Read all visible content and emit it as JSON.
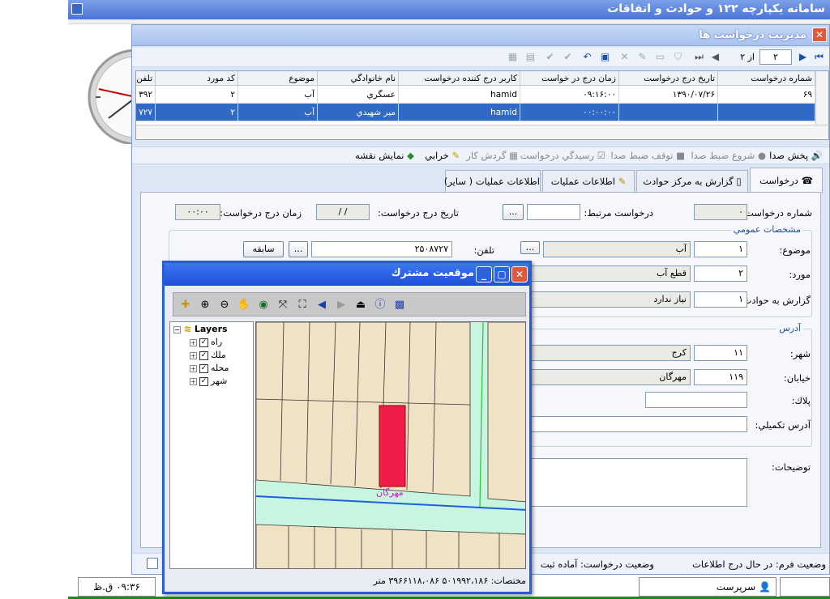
{
  "app": {
    "title": "سامانه يكپارچه ۱۲۲ و حوادث و اتفاقات"
  },
  "window": {
    "title": "مديريت درخواست ها",
    "close": "✕"
  },
  "toolbar1": {
    "page_current": "۲",
    "page_of": "از ۲"
  },
  "grid": {
    "headers": [
      "شماره درخواست",
      "تاريخ درج درخواست",
      "زمان درج در خواست",
      "كاربر درج كننده درخواست",
      "نام خانوادگي",
      "موضوع",
      "كد مورد",
      "تلفن"
    ],
    "rows": [
      [
        "۶۹",
        "۱۳۹۰/۰۷/۲۶",
        "۰۹:۱۶:۰۰",
        "hamid",
        "عسگري",
        "آب",
        "۲",
        "۳۹۲"
      ],
      [
        "",
        "",
        "۰۰:۰۰:۰۰",
        "hamid",
        "مير شهيدي",
        "آب",
        "۲",
        "۷۲۷"
      ]
    ]
  },
  "toolbar2": {
    "play_sound": "پخش صدا",
    "start_record": "شروع ضبط صدا",
    "stop_record": "توقف ضبط صدا",
    "receipt": "رسيدگي درخواست",
    "workflow": "گردش كار",
    "fault": "خرابي",
    "show_map": "نمايش نقشه"
  },
  "tabs": [
    "درخواست",
    "گزارش به مركز حوادث",
    "اطلاعات عمليات",
    "اطلاعات عمليات ( ساير)"
  ],
  "form": {
    "req_no_label": "شماره درخواست:",
    "req_no": "۰",
    "related_label": "درخواست مرتبط:",
    "related_btn": "...",
    "date_label": "تاريخ درج درخواست:",
    "date": "/ /",
    "time_label": "زمان درج درخواست:",
    "time": "۰۰:۰۰",
    "general_group": "مشخصات عمومي",
    "subject_label": "موضوع:",
    "subject_code": "۱",
    "subject_name": "آب",
    "subject_btn": "...",
    "phone_label": "تلفن:",
    "phone": "۲۵۰۸۷۲۷",
    "phone_btn": "...",
    "history_btn": "سابقه",
    "case_label": "مورد:",
    "case_code": "۲",
    "case_name": "قطع آب",
    "report_label": "گزارش به حوادث:",
    "report_code": "۱",
    "report_name": "نياز ندارد",
    "address_group": "آدرس",
    "city_label": "شهر:",
    "city_code": "۱۱",
    "city_name": "كرج",
    "street_label": "خيابان:",
    "street_code": "۱۱۹",
    "street_name": "مهرگان",
    "plate_label": "پلاك:",
    "extra_addr_label": "آدرس تكميلي:",
    "desc_label": "توضيحات:"
  },
  "status": {
    "form_state": "وضعيت فرم:  در حال درج اطلاعات",
    "req_state": "وضعيت درخواست:  آماده ثبت"
  },
  "taskbar": {
    "clock": "۰۹:۳۶ ق.ظ",
    "user": "سرپرست"
  },
  "map": {
    "title": "موقعيت مشترك",
    "layers_title": "Layers",
    "layers": [
      "راه",
      "ملك",
      "محله",
      "شهر"
    ],
    "street_label": "مهرگان",
    "coords": "مختصات: ۵۰۱۹۹۲،۱۸۶  ۳۹۶۶۱۱۸،۰۸۶ متر"
  }
}
